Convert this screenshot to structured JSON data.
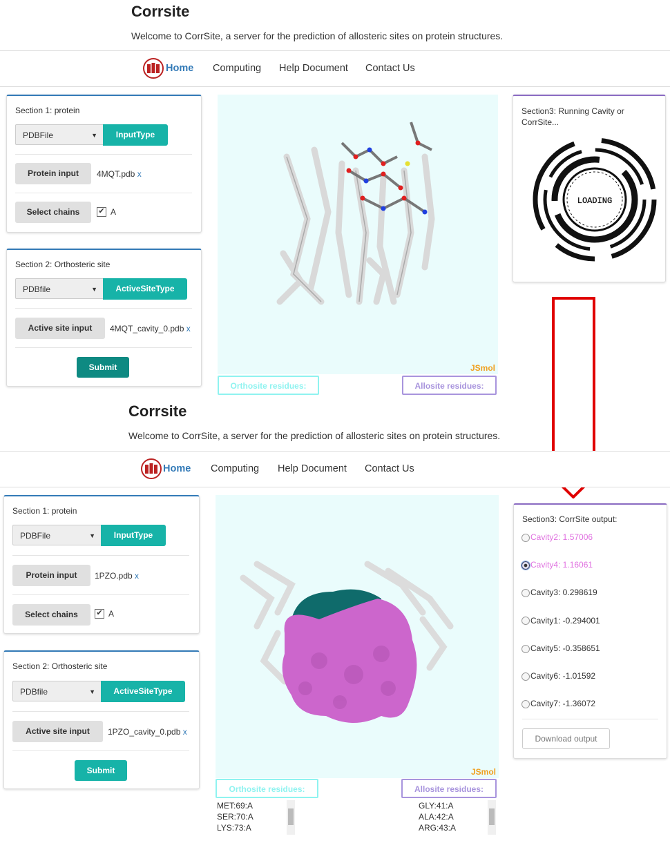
{
  "top": {
    "title": "Corrsite",
    "welcome": "Welcome to CorrSite, a server for the prediction of allosteric sites on protein structures.",
    "nav": [
      "Home",
      "Computing",
      "Help Document",
      "Contact Us"
    ],
    "section1": {
      "label": "Section 1: protein",
      "select_value": "PDBFile",
      "input_type_btn": "InputType",
      "protein_input_btn": "Protein input",
      "protein_file": "4MQT.pdb",
      "remove": "x",
      "select_chains_btn": "Select chains",
      "chain": "A"
    },
    "section2": {
      "label": "Section 2: Orthosteric site",
      "select_value": "PDBfile",
      "active_site_type_btn": "ActiveSiteType",
      "active_site_input_btn": "Active site input",
      "active_site_file": "4MQT_cavity_0.pdb",
      "remove": "x",
      "submit": "Submit"
    },
    "viewer": {
      "brand": "JSmol",
      "ortho_btn": "Orthosite residues:",
      "allo_btn": "Allosite residues:"
    },
    "section3": {
      "label": "Section3: Running Cavity or CorrSite...",
      "loading": "LOADING"
    }
  },
  "bottom": {
    "title": "Corrsite",
    "welcome": "Welcome to CorrSite, a server for the prediction of allosteric sites on protein structures.",
    "nav": [
      "Home",
      "Computing",
      "Help Document",
      "Contact Us"
    ],
    "section1": {
      "label": "Section 1: protein",
      "select_value": "PDBFile",
      "input_type_btn": "InputType",
      "protein_input_btn": "Protein input",
      "protein_file": "1PZO.pdb",
      "remove": "x",
      "select_chains_btn": "Select chains",
      "chain": "A"
    },
    "section2": {
      "label": "Section 2: Orthosteric site",
      "select_value": "PDBfile",
      "active_site_type_btn": "ActiveSiteType",
      "active_site_input_btn": "Active site input",
      "active_site_file": "1PZO_cavity_0.pdb",
      "remove": "x",
      "submit": "Submit"
    },
    "viewer": {
      "brand": "JSmol",
      "ortho_btn": "Orthosite residues:",
      "allo_btn": "Allosite residues:"
    },
    "ortho_residues": [
      "MET:69:A",
      "SER:70:A",
      "LYS:73:A"
    ],
    "allo_residues": [
      "GLY:41:A",
      "ALA:42:A",
      "ARG:43:A"
    ],
    "section3": {
      "label": "Section3: CorrSite output:",
      "cavities": [
        {
          "label": "Cavity2: 1.57006",
          "color": "#e070e0",
          "checked": false
        },
        {
          "label": "Cavity4: 1.16061",
          "color": "#e070e0",
          "checked": true
        },
        {
          "label": "Cavity3: 0.298619",
          "color": "#333333",
          "checked": false
        },
        {
          "label": "Cavity1: -0.294001",
          "color": "#333333",
          "checked": false
        },
        {
          "label": "Cavity5: -0.358651",
          "color": "#333333",
          "checked": false
        },
        {
          "label": "Cavity6: -1.01592",
          "color": "#333333",
          "checked": false
        },
        {
          "label": "Cavity7: -1.36072",
          "color": "#333333",
          "checked": false
        }
      ],
      "download": "Download output"
    }
  },
  "colors": {
    "teal": "#17b3a8",
    "dark_teal": "#0e8a82",
    "arrow": "#e00000",
    "allo_purple": "#a894dd",
    "ortho_cyan": "#8ff3f0"
  }
}
